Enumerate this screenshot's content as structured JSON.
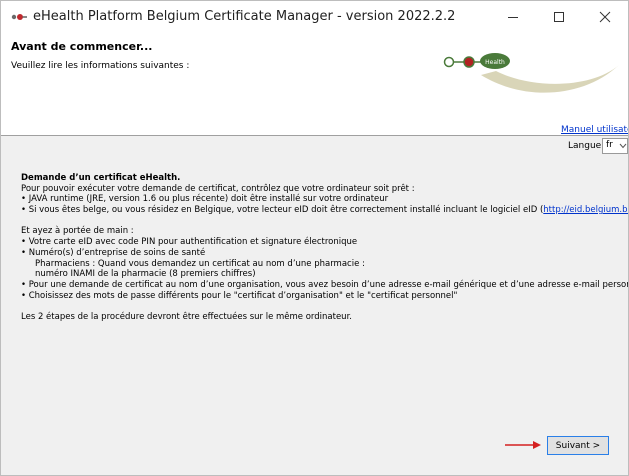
{
  "window": {
    "title": "eHealth Platform Belgium Certificate Manager - version 2022.2.2"
  },
  "header": {
    "title": "Avant de commencer...",
    "subtitle": "Veuillez lire les informations suivantes :",
    "logo_text": "Health"
  },
  "toolbar": {
    "manual_link": "Manuel utilisateur",
    "language_label": "Langue",
    "language_value": "fr"
  },
  "content": {
    "heading": "Demande d’un certificat eHealth.",
    "intro": "Pour pouvoir exécuter votre demande de certificat, contrôlez que votre ordinateur soit prêt :",
    "req1": "• JAVA runtime (JRE, version 1.6 ou plus récente) doit être installé sur votre ordinateur",
    "req2_prefix": "• Si vous êtes belge, ou vous résidez en Belgique, votre lecteur eID doit être correctement installé incluant le logiciel eID (",
    "req2_link": "http://eid.belgium.be",
    "req2_suffix": ")",
    "have_title": "Et ayez à portée de main :",
    "have1": "• Votre carte eID avec code PIN pour authentification et signature électronique",
    "have2": "• Numéro(s) d’entreprise de soins de santé",
    "have2_sub1": "Pharmaciens : Quand vous demandez un certificat au nom d’une pharmacie :",
    "have2_sub2": "numéro INAMI de la pharmacie (8 premiers chiffres)",
    "have3": "• Pour une demande de certificat au nom d’une organisation, vous avez besoin d’une adresse e-mail générique et d’une adresse e-mail personnelle",
    "have4": "• Choisissez des mots de passe différents pour le \"certificat d’organisation\" et le \"certificat personnel\"",
    "footer": "Les 2 étapes de la procédure devront être effectuées sur le même ordinateur."
  },
  "actions": {
    "next_label": "Suivant >"
  },
  "colors": {
    "link": "#0033cc",
    "logo_green": "#4a7a3a",
    "logo_red": "#b22222",
    "arrow_red": "#d42020",
    "button_focus": "#2a7fe8"
  },
  "icons": {
    "app": "ehealth-app-icon",
    "minimize": "minimize-icon",
    "maximize": "maximize-icon",
    "close": "close-icon",
    "language_dropdown": "chevron-down-icon",
    "annotation": "arrow-right-icon"
  }
}
